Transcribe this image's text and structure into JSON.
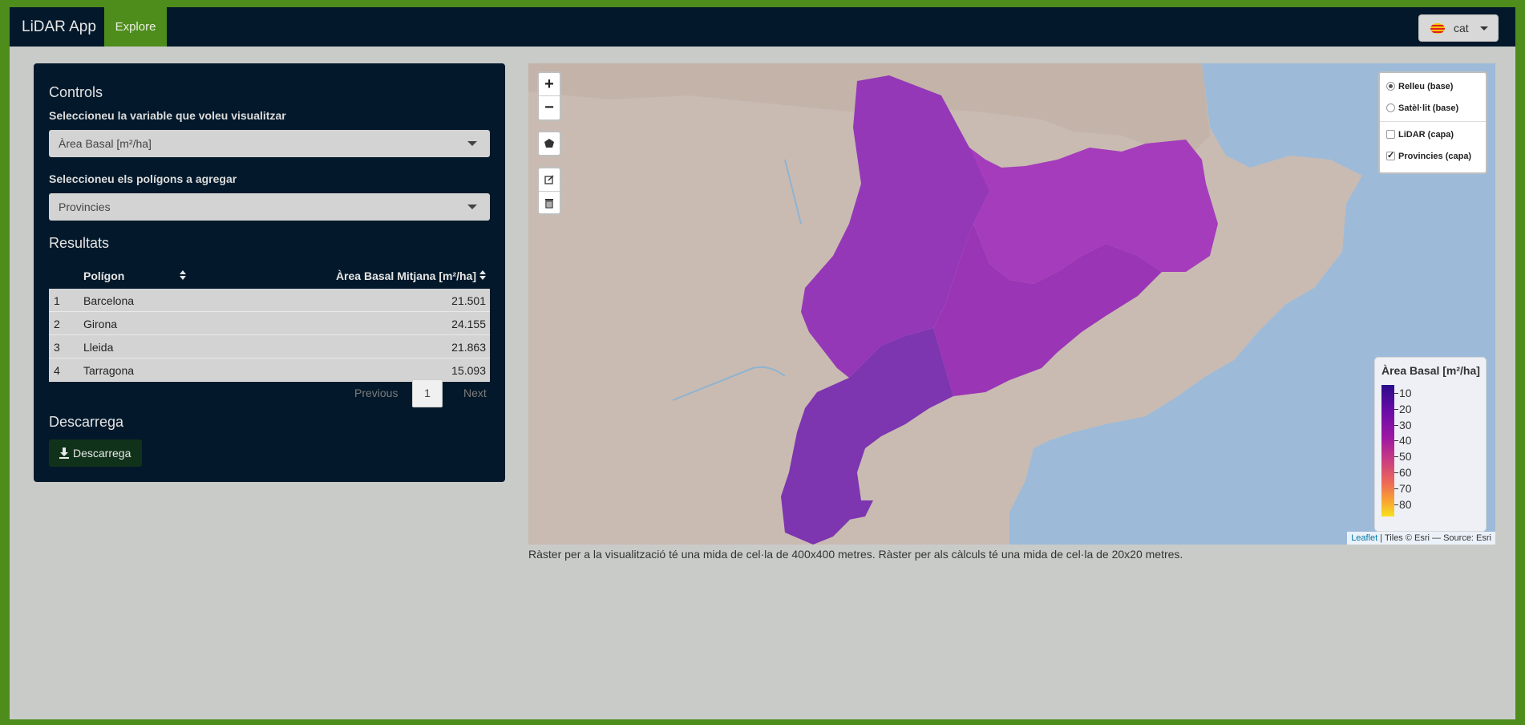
{
  "navbar": {
    "brand": "LiDAR App",
    "tab_explore": "Explore",
    "language": "cat"
  },
  "panel": {
    "title": "Controls",
    "variable_label": "Seleccioneu la variable que voleu visualitzar",
    "variable_value": "Àrea Basal [m²/ha]",
    "polygons_label": "Seleccioneu els polígons a agregar",
    "polygons_value": "Provincies",
    "results_title": "Resultats",
    "table": {
      "col_polygon": "Polígon",
      "col_value": "Àrea Basal Mitjana [m²/ha]",
      "rows": [
        {
          "idx": "1",
          "name": "Barcelona",
          "value": "21.501"
        },
        {
          "idx": "2",
          "name": "Girona",
          "value": "24.155"
        },
        {
          "idx": "3",
          "name": "Lleida",
          "value": "21.863"
        },
        {
          "idx": "4",
          "name": "Tarragona",
          "value": "15.093"
        }
      ]
    },
    "pagination": {
      "previous": "Previous",
      "page": "1",
      "next": "Next"
    },
    "download_title": "Descarrega",
    "download_button": "Descarrega"
  },
  "map": {
    "zoom_in": "+",
    "zoom_out": "−",
    "layers": {
      "relleu": "Relleu (base)",
      "satelit": "Satèl·lit (base)",
      "lidar": "LiDAR (capa)",
      "provincies": "Provincies (capa)",
      "relleu_selected": true,
      "provincies_checked": true
    },
    "legend": {
      "title": "Àrea Basal [m²/ha]",
      "ticks": [
        "10",
        "20",
        "30",
        "40",
        "50",
        "60",
        "70",
        "80"
      ]
    },
    "attribution_link": "Leaflet",
    "attribution_text": " | Tiles © Esri — Source: Esri",
    "colors": {
      "sea": "#9dbbd9",
      "land": "#c9bbb2",
      "barcelona": "#9a35b6",
      "tarragona": "#7d35b0",
      "girona": "#a53cbb",
      "lleida": "#9438b8"
    }
  },
  "caption": "Ràster per a la visualització té una mida de cel·la de 400x400 metres. Ràster per als càlculs té una mida de cel·la de 20x20 metres."
}
